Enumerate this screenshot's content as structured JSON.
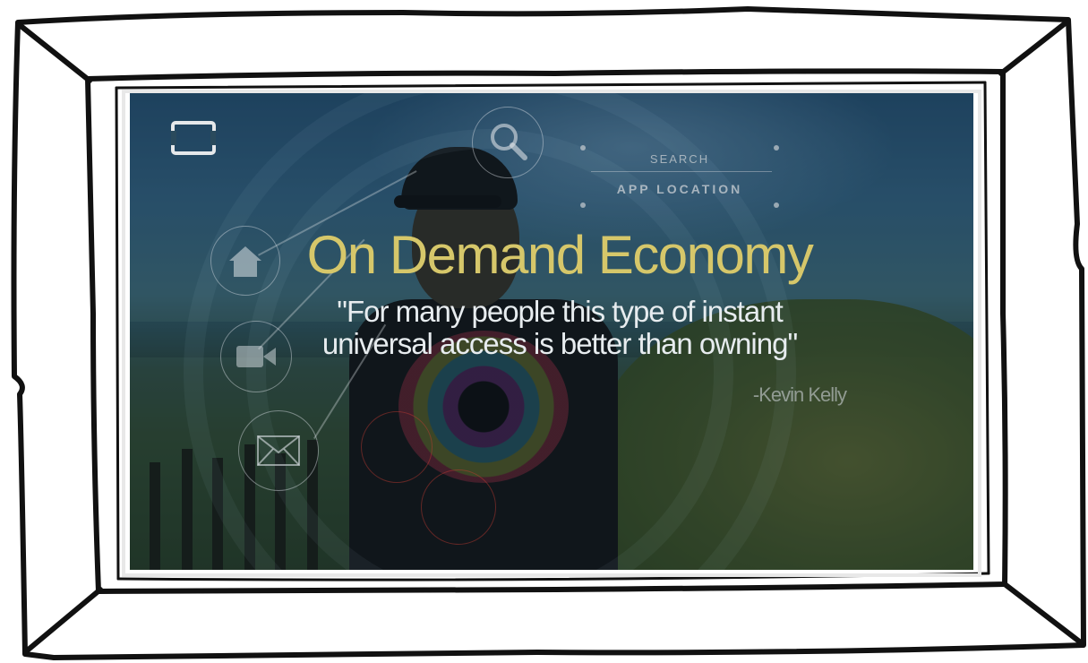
{
  "video": {
    "title": "On Demand Economy",
    "quote_line1": "\"For many people this type of instant",
    "quote_line2": "universal access is better than owning\"",
    "author": "-Kevin Kelly"
  },
  "overlay": {
    "search_label": "SEARCH",
    "location_label": "APP LOCATION"
  },
  "icons": [
    "screen-logo-icon",
    "search-icon",
    "home-icon",
    "video-camera-icon",
    "mail-icon"
  ],
  "colors": {
    "title": "#d6c76a",
    "quote": "#e7ecef",
    "frame_stroke": "#111111"
  }
}
